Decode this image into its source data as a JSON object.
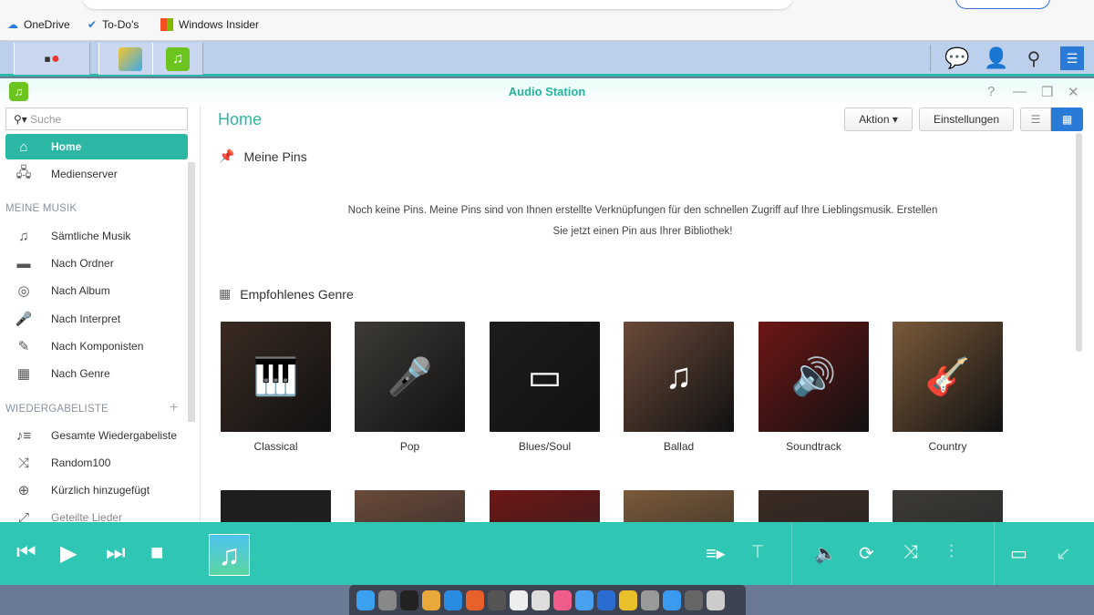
{
  "browser": {
    "bookmarks": [
      "OneDrive",
      "To-Do's",
      "Windows Insider"
    ]
  },
  "taskbar": {
    "apps": [
      "main-menu",
      "package-center",
      "audio-station"
    ],
    "right_icons": [
      "chat-icon",
      "user-icon",
      "search-icon",
      "widgets-icon"
    ]
  },
  "window": {
    "title": "Audio Station",
    "controls": [
      "?",
      "—",
      "❐",
      "✕"
    ]
  },
  "sidebar": {
    "search_placeholder": "Suche",
    "top": [
      {
        "label": "Home",
        "icon": "⌂",
        "active": true
      },
      {
        "label": "Medienserver",
        "icon": "🖧"
      }
    ],
    "music_header": "MEINE MUSIK",
    "music": [
      {
        "label": "Sämtliche Musik",
        "icon": "♫"
      },
      {
        "label": "Nach Ordner",
        "icon": "▬"
      },
      {
        "label": "Nach Album",
        "icon": "◎"
      },
      {
        "label": "Nach Interpret",
        "icon": "🎤"
      },
      {
        "label": "Nach Komponisten",
        "icon": "✎"
      },
      {
        "label": "Nach Genre",
        "icon": "▦"
      }
    ],
    "playlist_header": "WIEDERGABELISTE",
    "playlist_add": "+",
    "playlists": [
      {
        "label": "Gesamte Wiedergabeliste",
        "icon": "♪≡"
      },
      {
        "label": "Random100",
        "icon": "⤨"
      },
      {
        "label": "Kürzlich hinzugefügt",
        "icon": "⊕"
      },
      {
        "label": "Geteilte Lieder",
        "icon": "⤢"
      }
    ]
  },
  "main": {
    "title": "Home",
    "action_label": "Aktion ▾",
    "settings_label": "Einstellungen",
    "pins_title": "Meine Pins",
    "pins_empty": "Noch keine Pins. Meine Pins sind von Ihnen erstellte Verknüpfungen für den schnellen Zugriff auf Ihre Lieblingsmusik. Erstellen Sie jetzt einen Pin aus Ihrer Bibliothek!",
    "genre_title": "Empfohlenes Genre",
    "genres": [
      {
        "label": "Classical",
        "icon": "🎹"
      },
      {
        "label": "Pop",
        "icon": "🎤"
      },
      {
        "label": "Blues/Soul",
        "icon": "▭"
      },
      {
        "label": "Ballad",
        "icon": "♫"
      },
      {
        "label": "Soundtrack",
        "icon": "🔊"
      },
      {
        "label": "Country",
        "icon": "🎸"
      }
    ]
  },
  "player": {
    "controls": [
      "⏮",
      "▶",
      "⏭",
      "■"
    ],
    "right": [
      "≡▸",
      "T",
      "🔈",
      "⟳",
      "⤨",
      "⫶",
      "▭",
      "↙"
    ]
  }
}
